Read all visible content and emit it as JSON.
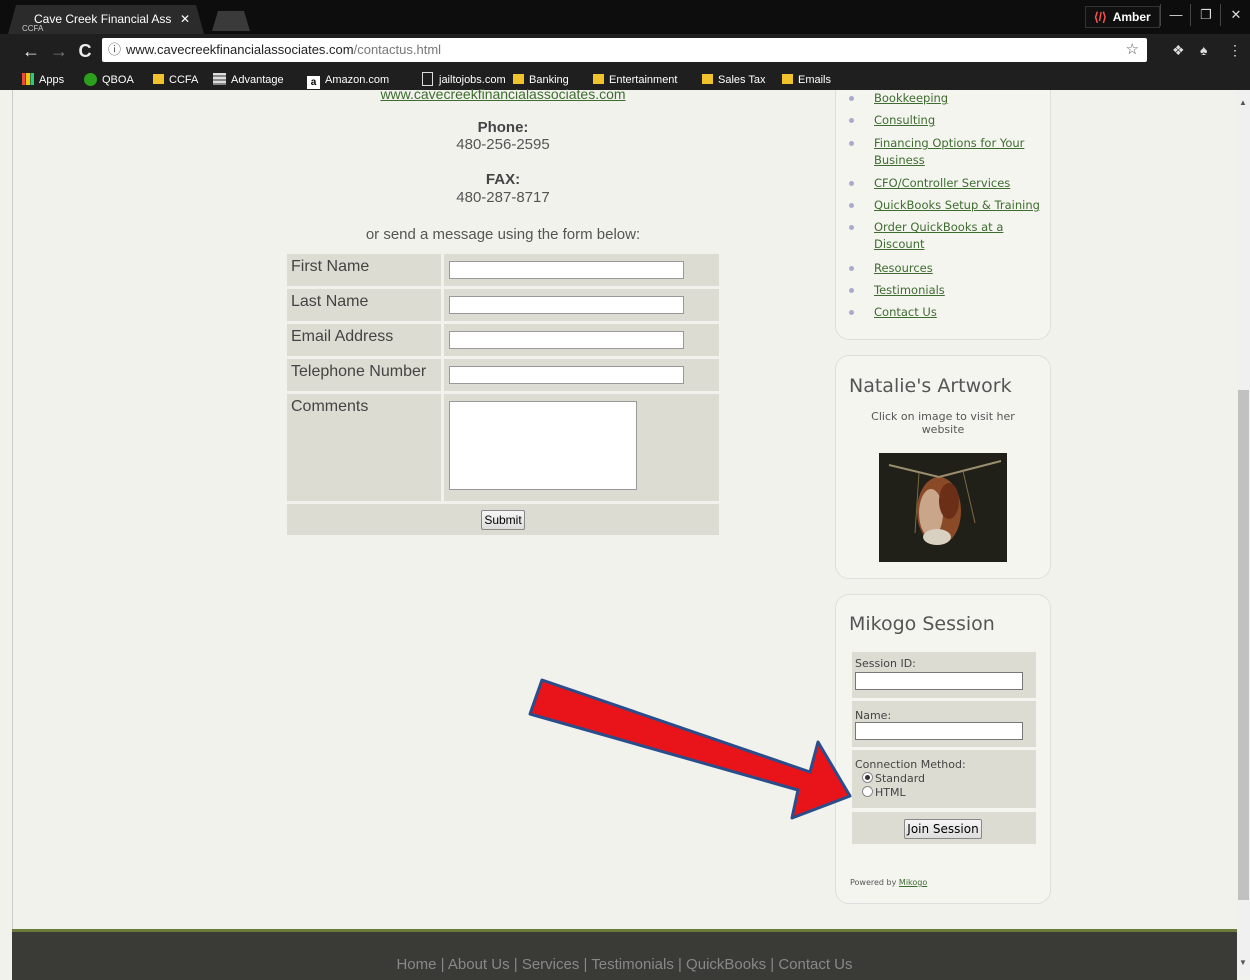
{
  "browser": {
    "tab_title": "Cave Creek Financial Ass",
    "tab_favicon": "CCFA",
    "profile_name": "Amber",
    "url_host": "www.cavecreekfinancialassociates.com",
    "url_path": "/contactus.html",
    "bookmarks": [
      {
        "label": "Apps",
        "icon": "apps-icon"
      },
      {
        "label": "QBOA",
        "icon": "quickbooks-icon"
      },
      {
        "label": "CCFA",
        "icon": "folder-icon"
      },
      {
        "label": "Advantage",
        "icon": "advantage-icon"
      },
      {
        "label": "Amazon.com",
        "icon": "amazon-icon"
      },
      {
        "label": "jailtojobs.com",
        "icon": "page-icon"
      },
      {
        "label": "Banking",
        "icon": "folder-icon"
      },
      {
        "label": "Entertainment",
        "icon": "folder-icon"
      },
      {
        "label": "Sales Tax",
        "icon": "folder-icon"
      },
      {
        "label": "Emails",
        "icon": "folder-icon"
      }
    ]
  },
  "contact": {
    "website_link": "www.cavecreekfinancialassociates.com",
    "phone_label": "Phone:",
    "phone_value": "480-256-2595",
    "fax_label": "FAX:",
    "fax_value": "480-287-8717",
    "form_intro": "or send a message using the form below:"
  },
  "form": {
    "fields": [
      "First Name",
      "Last Name",
      "Email Address",
      "Telephone Number",
      "Comments"
    ],
    "submit_label": "Submit"
  },
  "sidebar": {
    "nav_items": [
      "Bookkeeping",
      "Consulting",
      "Financing Options for Your Business",
      "CFO/Controller Services",
      "QuickBooks Setup & Training",
      "Order QuickBooks at a Discount",
      "Resources",
      "Testimonials",
      "Contact Us"
    ],
    "artwork": {
      "title": "Natalie's Artwork",
      "caption": "Click on image to visit her website"
    },
    "mikogo": {
      "title": "Mikogo Session",
      "session_id_label": "Session ID:",
      "name_label": "Name:",
      "connection_label": "Connection Method:",
      "option_standard": "Standard",
      "option_html": "HTML",
      "join_label": "Join Session",
      "powered_by": "Powered by",
      "powered_link": "Mikogo"
    }
  },
  "footer": {
    "links": "Home | About Us | Services | Testimonials | QuickBooks | Contact Us"
  },
  "colors": {
    "page_bg": "#f2f2ec",
    "link_green": "#3e6c30",
    "arrow_red": "#e8141a",
    "arrow_outline": "#2a4d8c"
  }
}
